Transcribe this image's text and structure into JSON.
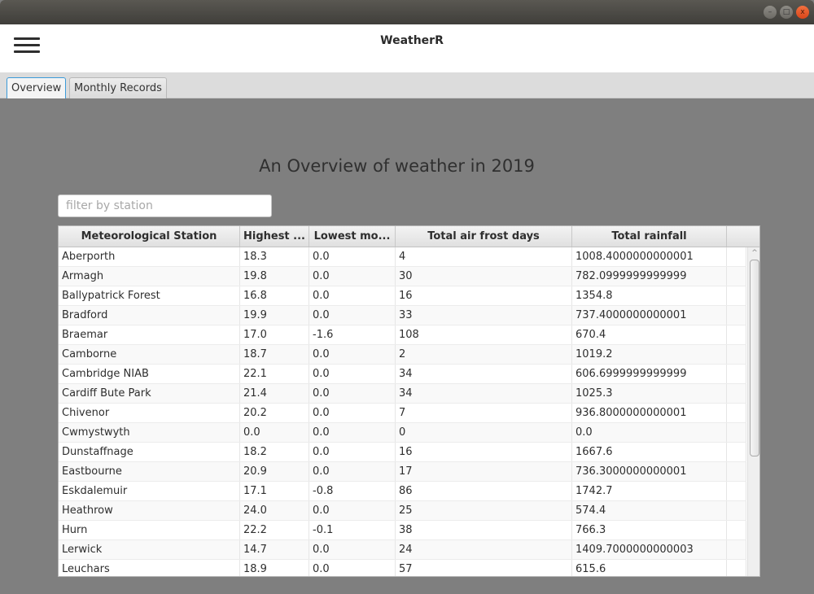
{
  "window": {
    "controls": {
      "minimize": "–",
      "maximize": "□",
      "close": "x"
    }
  },
  "appbar": {
    "title": "WeatherR",
    "menu_icon": "hamburger-menu-icon"
  },
  "tabs": [
    {
      "label": "Overview",
      "active": true
    },
    {
      "label": "Monthly Records",
      "active": false
    }
  ],
  "overview": {
    "title": "An Overview of weather in 2019",
    "filter": {
      "placeholder": "filter by station",
      "value": ""
    },
    "table": {
      "columns": [
        "Meteorological Station",
        "Highest ...",
        "Lowest mo...",
        "Total air frost days",
        "Total rainfall"
      ],
      "rows": [
        [
          "Aberporth",
          "18.3",
          "0.0",
          "4",
          "1008.4000000000001"
        ],
        [
          "Armagh",
          "19.8",
          "0.0",
          "30",
          "782.0999999999999"
        ],
        [
          "Ballypatrick Forest",
          "16.8",
          "0.0",
          "16",
          "1354.8"
        ],
        [
          "Bradford",
          "19.9",
          "0.0",
          "33",
          "737.4000000000001"
        ],
        [
          "Braemar",
          "17.0",
          "-1.6",
          "108",
          "670.4"
        ],
        [
          "Camborne",
          "18.7",
          "0.0",
          "2",
          "1019.2"
        ],
        [
          "Cambridge NIAB",
          "22.1",
          "0.0",
          "34",
          "606.6999999999999"
        ],
        [
          "Cardiff Bute Park",
          "21.4",
          "0.0",
          "34",
          "1025.3"
        ],
        [
          "Chivenor",
          "20.2",
          "0.0",
          "7",
          "936.8000000000001"
        ],
        [
          "Cwmystwyth",
          "0.0",
          "0.0",
          "0",
          "0.0"
        ],
        [
          "Dunstaffnage",
          "18.2",
          "0.0",
          "16",
          "1667.6"
        ],
        [
          "Eastbourne",
          "20.9",
          "0.0",
          "17",
          "736.3000000000001"
        ],
        [
          "Eskdalemuir",
          "17.1",
          "-0.8",
          "86",
          "1742.7"
        ],
        [
          "Heathrow",
          "24.0",
          "0.0",
          "25",
          "574.4"
        ],
        [
          "Hurn",
          "22.2",
          "-0.1",
          "38",
          "766.3"
        ],
        [
          "Lerwick",
          "14.7",
          "0.0",
          "24",
          "1409.7000000000003"
        ],
        [
          "Leuchars",
          "18.9",
          "0.0",
          "57",
          "615.6"
        ]
      ]
    },
    "scrollbar": {
      "up_arrow": "^"
    }
  }
}
